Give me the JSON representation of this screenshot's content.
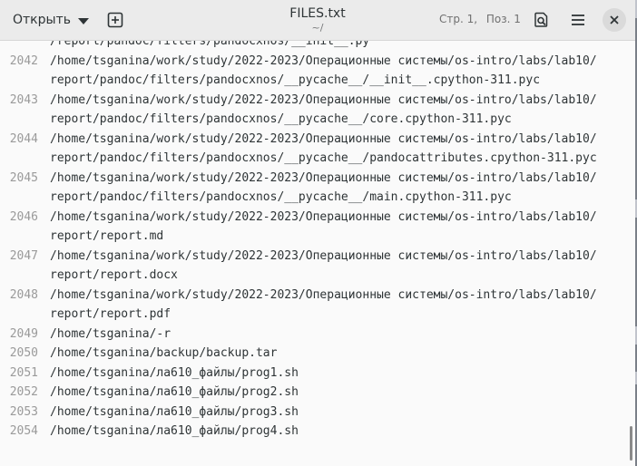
{
  "header": {
    "open_label": "Открыть",
    "title": "FILES.txt",
    "subtitle": "~/",
    "status": {
      "line": "Стр. 1,",
      "col": "Поз. 1"
    }
  },
  "icons": {
    "new_document": "new-document-icon",
    "open_dropdown": "chevron-down-icon",
    "search": "search-icon",
    "menu": "hamburger-menu-icon",
    "close": "close-icon"
  },
  "editor": {
    "lines": [
      {
        "num": "",
        "text": "/report/pandoc/filters/pandocxnos/__init__.py"
      },
      {
        "num": "2042",
        "text": "/home/tsganina/work/study/2022-2023/Операционные системы/os-intro/labs/lab10/"
      },
      {
        "num": "",
        "text": "report/pandoc/filters/pandocxnos/__pycache__/__init__.cpython-311.pyc"
      },
      {
        "num": "2043",
        "text": "/home/tsganina/work/study/2022-2023/Операционные системы/os-intro/labs/lab10/"
      },
      {
        "num": "",
        "text": "report/pandoc/filters/pandocxnos/__pycache__/core.cpython-311.pyc"
      },
      {
        "num": "2044",
        "text": "/home/tsganina/work/study/2022-2023/Операционные системы/os-intro/labs/lab10/"
      },
      {
        "num": "",
        "text": "report/pandoc/filters/pandocxnos/__pycache__/pandocattributes.cpython-311.pyc"
      },
      {
        "num": "2045",
        "text": "/home/tsganina/work/study/2022-2023/Операционные системы/os-intro/labs/lab10/"
      },
      {
        "num": "",
        "text": "report/pandoc/filters/pandocxnos/__pycache__/main.cpython-311.pyc"
      },
      {
        "num": "2046",
        "text": "/home/tsganina/work/study/2022-2023/Операционные системы/os-intro/labs/lab10/"
      },
      {
        "num": "",
        "text": "report/report.md"
      },
      {
        "num": "2047",
        "text": "/home/tsganina/work/study/2022-2023/Операционные системы/os-intro/labs/lab10/"
      },
      {
        "num": "",
        "text": "report/report.docx"
      },
      {
        "num": "2048",
        "text": "/home/tsganina/work/study/2022-2023/Операционные системы/os-intro/labs/lab10/"
      },
      {
        "num": "",
        "text": "report/report.pdf"
      },
      {
        "num": "2049",
        "text": "/home/tsganina/-r"
      },
      {
        "num": "2050",
        "text": "/home/tsganina/backup/backup.tar"
      },
      {
        "num": "2051",
        "text": "/home/tsganina/ла610_файлы/prog1.sh"
      },
      {
        "num": "2052",
        "text": "/home/tsganina/ла610_файлы/prog2.sh"
      },
      {
        "num": "2053",
        "text": "/home/tsganina/ла610_файлы/prog3.sh"
      },
      {
        "num": "2054",
        "text": "/home/tsganina/ла610_файлы/prog4.sh"
      }
    ]
  },
  "colors": {
    "header_bg": "#ebebeb",
    "editor_bg": "#fafafa",
    "text": "#2e3436",
    "line_number": "#9a9a9a"
  }
}
